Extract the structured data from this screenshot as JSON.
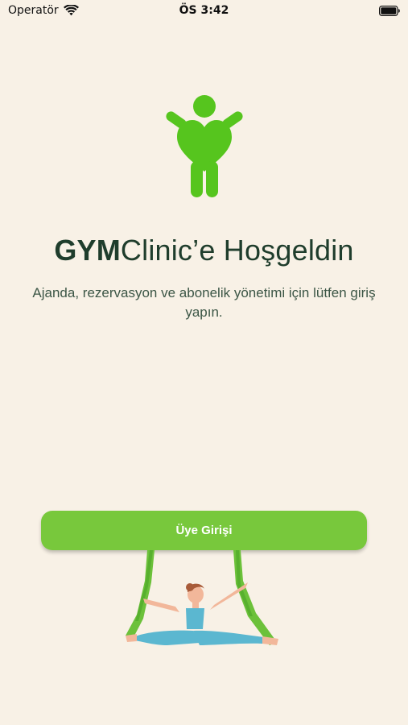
{
  "status_bar": {
    "carrier": "Operatör",
    "time": "ÖS 3:42"
  },
  "welcome": {
    "title_bold": "GYM",
    "title_rest": "Clinic’e Hoşgeldin",
    "subtitle": "Ajanda, rezervasyon ve abonelik yönetimi için lütfen giriş yapın."
  },
  "actions": {
    "member_login_label": "Üye Girişi"
  },
  "colors": {
    "background": "#f8f1e6",
    "accent": "#78c83c",
    "logo": "#56c51e",
    "title_text": "#1f3d2c"
  },
  "icons": {
    "logo": "person-heart-logo-icon",
    "wifi": "wifi-icon",
    "battery": "battery-icon",
    "illustration": "aerial-yoga-illustration"
  }
}
